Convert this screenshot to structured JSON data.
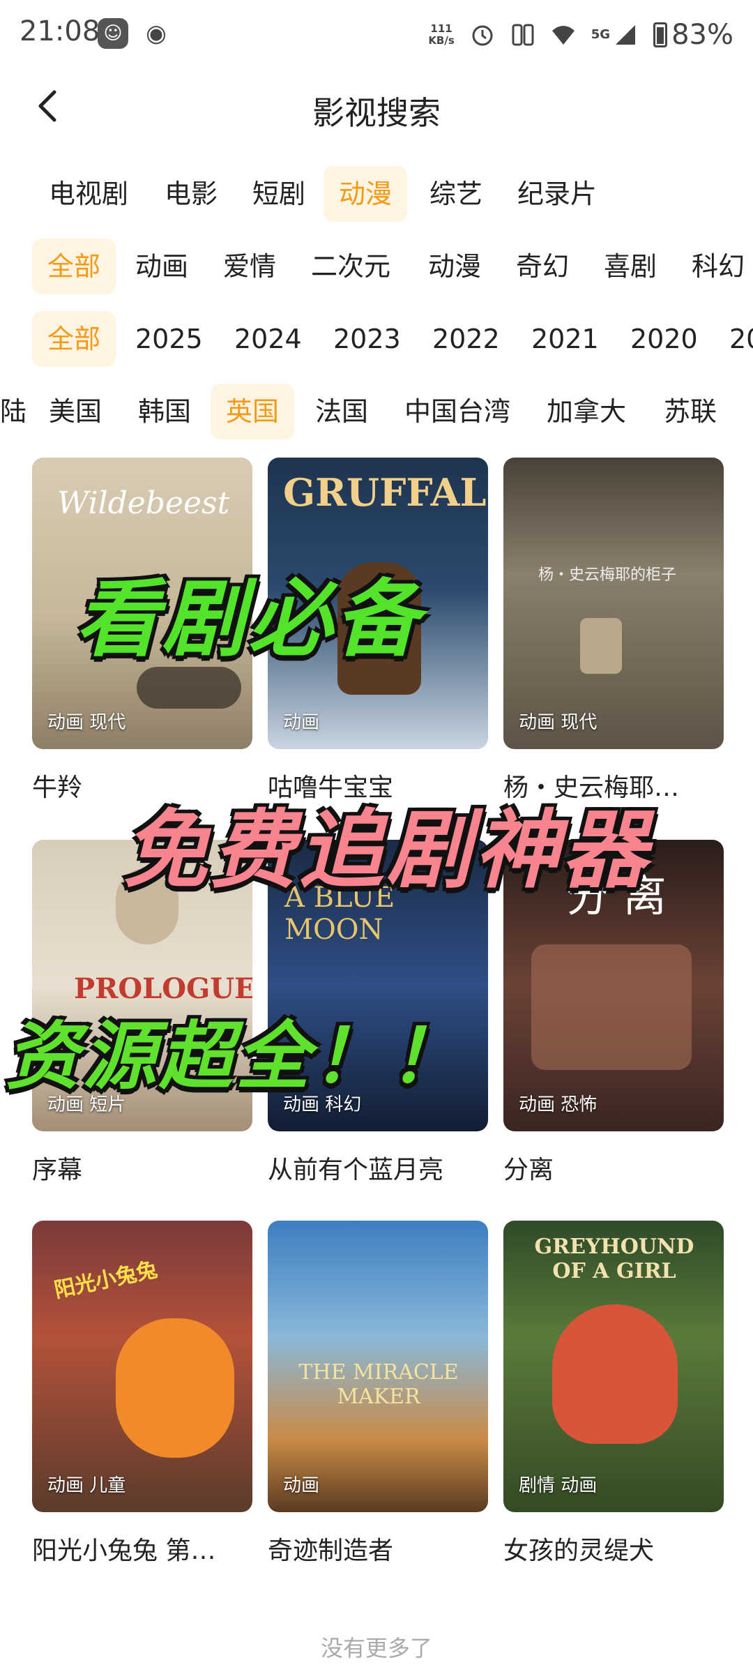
{
  "status_bar": {
    "time": "21:08",
    "net_speed_value": "111",
    "net_speed_unit": "KB/s",
    "signal_label": "5G",
    "battery": "83%"
  },
  "header": {
    "title": "影视搜索"
  },
  "filters": {
    "types": [
      "电视剧",
      "电影",
      "短剧",
      "动漫",
      "综艺",
      "纪录片"
    ],
    "type_selected": "动漫",
    "genres": [
      "全部",
      "动画",
      "爱情",
      "二次元",
      "动漫",
      "奇幻",
      "喜剧",
      "科幻"
    ],
    "genre_selected": "全部",
    "years": [
      "全部",
      "2025",
      "2024",
      "2023",
      "2022",
      "2021",
      "2020",
      "20"
    ],
    "year_selected": "全部",
    "regions": [
      "陆",
      "美国",
      "韩国",
      "英国",
      "法国",
      "中国台湾",
      "加拿大",
      "苏联"
    ],
    "region_selected": "英国"
  },
  "results": [
    {
      "title": "牛羚",
      "tags": "动画 现代",
      "poster_text": "Wildebeest",
      "color": "#cdbfa5"
    },
    {
      "title": "咕噜牛宝宝",
      "tags": "动画",
      "poster_text": "GRUFFALO",
      "color": "#2e4a6b"
    },
    {
      "title": "杨・史云梅耶…",
      "tags": "动画 现代",
      "poster_text": "杨・史云梅耶的柜子",
      "color": "#6f6656"
    },
    {
      "title": "序幕",
      "tags": "动画 短片",
      "poster_text": "PROLOGUE",
      "color": "#d9cfbf"
    },
    {
      "title": "从前有个蓝月亮",
      "tags": "动画 科幻",
      "poster_text": "A BLUE MOON",
      "color": "#1f3456"
    },
    {
      "title": "分离",
      "tags": "动画 恐怖",
      "poster_text": "分 离",
      "color": "#4a3029"
    },
    {
      "title": "阳光小兔兔 第…",
      "tags": "动画 儿童",
      "poster_text": "阳光小兔兔",
      "color": "#c0563a"
    },
    {
      "title": "奇迹制造者",
      "tags": "动画",
      "poster_text": "THE MIRACLE MAKER",
      "color": "#3f6fa8"
    },
    {
      "title": "女孩的灵缇犬",
      "tags": "剧情 动画",
      "poster_text": "GREYHOUND OF A GIRL",
      "color": "#3c5a2e"
    }
  ],
  "overlays": [
    "看剧必备",
    "免费追剧神器",
    "资源超全！！"
  ],
  "footer": {
    "no_more": "没有更多了"
  }
}
